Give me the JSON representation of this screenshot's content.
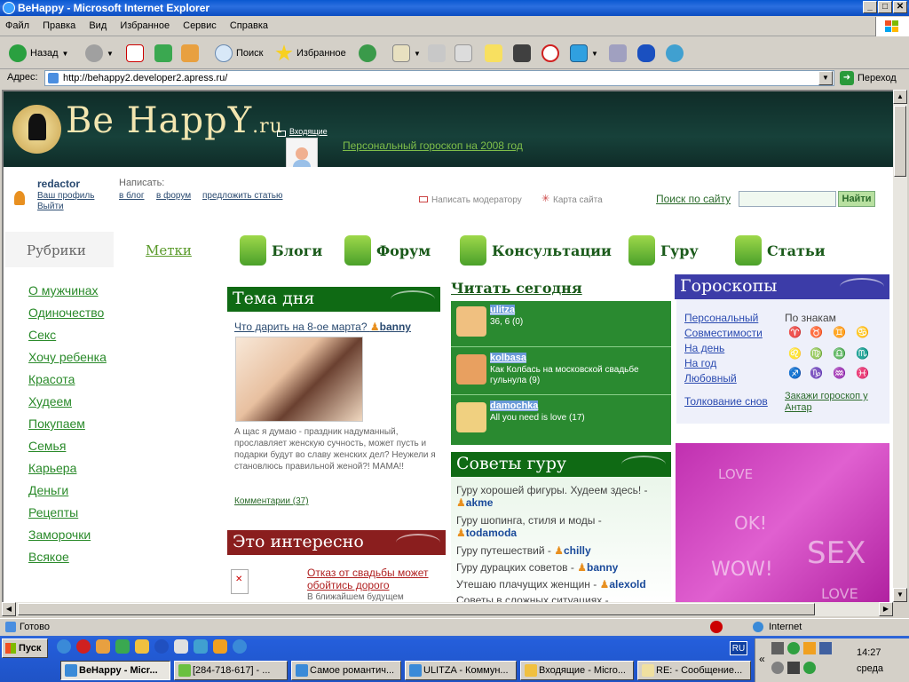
{
  "window": {
    "title": "BeHappy - Microsoft Internet Explorer"
  },
  "menu": [
    "Файл",
    "Правка",
    "Вид",
    "Избранное",
    "Сервис",
    "Справка"
  ],
  "toolbar": {
    "back": "Назад",
    "search": "Поиск",
    "favorites": "Избранное"
  },
  "address": {
    "label": "Адрес:",
    "url": "http://behappy2.developer2.apress.ru/",
    "go": "Переход"
  },
  "site": {
    "logo": "Be HappY",
    "logo_ru": ".ru",
    "inbox": "Входящие",
    "horoscope_link": "Персональный гороскоп на 2008 год",
    "username": "redactor",
    "profile_link": "Ваш профиль",
    "logout_link": "Выйти",
    "write_label": "Написать:",
    "write_blog": "в блог",
    "write_forum": "в форум",
    "suggest_article": "предложить статью",
    "moderator": "Написать модератору",
    "sitemap": "Карта сайта",
    "search_label": "Поиск по сайту",
    "search_button": "Найти"
  },
  "tabs": {
    "rubrics": "Рубрики",
    "tags": "Метки"
  },
  "rubrics": [
    "О мужчинах",
    "Одиночество",
    "Секс",
    "Хочу ребенка",
    "Красота",
    "Худеем",
    "Покупаем",
    "Семья",
    "Карьера",
    "Деньги",
    "Рецепты",
    "Заморочки",
    "Всякое"
  ],
  "nav": [
    "Блоги",
    "Форум",
    "Консультации",
    "Гуру",
    "Статьи"
  ],
  "tema": {
    "header": "Тема дня",
    "question": "Что дарить на 8-ое марта?",
    "author": "banny",
    "text": "А щас я думаю - праздник надуманный, прославляет женскую сучность, может пусть и подарки будут во славу женских дел? Неужели я становлюсь правильной женой?! МАМА!!",
    "comments": "Комментарии (37)"
  },
  "interesting": {
    "header": "Это интересно",
    "title": "Отказ от свадьбы может обойтись дорого",
    "text": "В ближайшем будущем"
  },
  "read_today": {
    "header": "Читать сегодня",
    "items": [
      {
        "name": "ulitza",
        "text": "36, 6 (0)"
      },
      {
        "name": "kolbasa",
        "text": "Как Колбась на московской свадьбе гульнула (9)"
      },
      {
        "name": "damochka",
        "text": "All you need is love (17)"
      }
    ]
  },
  "guru_advice": {
    "header": "Советы гуру",
    "items": [
      {
        "text": "Гуру хорошей фигуры. Худеем здесь! -",
        "user": "akme"
      },
      {
        "text": "Гуру шопинга, стиля и моды -",
        "user": "todamoda"
      },
      {
        "text": "Гуру путешествий -",
        "user": "chilly"
      },
      {
        "text": "Гуру дурацких советов -",
        "user": "banny"
      },
      {
        "text": "Утешаю плачущих женщин -",
        "user": "alexold"
      },
      {
        "text": "Советы в сложных ситуациях -",
        "user": ""
      }
    ]
  },
  "horoscopes": {
    "header": "Гороскопы",
    "links": [
      "Персональный",
      "Совместимости",
      "На день",
      "На год",
      "Любовный"
    ],
    "by_signs": "По знакам",
    "signs": [
      "♈",
      "♉",
      "♊",
      "♋",
      "♌",
      "♍",
      "♎",
      "♏",
      "♐",
      "♑",
      "♒",
      "♓"
    ],
    "order": "Закажи гороскоп у Антар",
    "dreams": "Толкование снов"
  },
  "ad": {
    "words": [
      "LOVE",
      "OK!",
      "WOW!",
      "SEX",
      "LOVE"
    ]
  },
  "status": {
    "text": "Готово",
    "zone": "Internet"
  },
  "taskbar": {
    "start": "Пуск",
    "tasks": [
      "BeHappy - Micr...",
      "[284-718-617] - ...",
      "Самое романтич...",
      "ULITZA - Коммун...",
      "Входящие - Micro...",
      "RE: - Сообщение..."
    ],
    "lang": "RU",
    "time": "14:27",
    "day": "среда"
  },
  "colors": {
    "accent_green": "#0f6a14",
    "link_green": "#2a8a2a",
    "horo_blue": "#3c3ca8"
  }
}
